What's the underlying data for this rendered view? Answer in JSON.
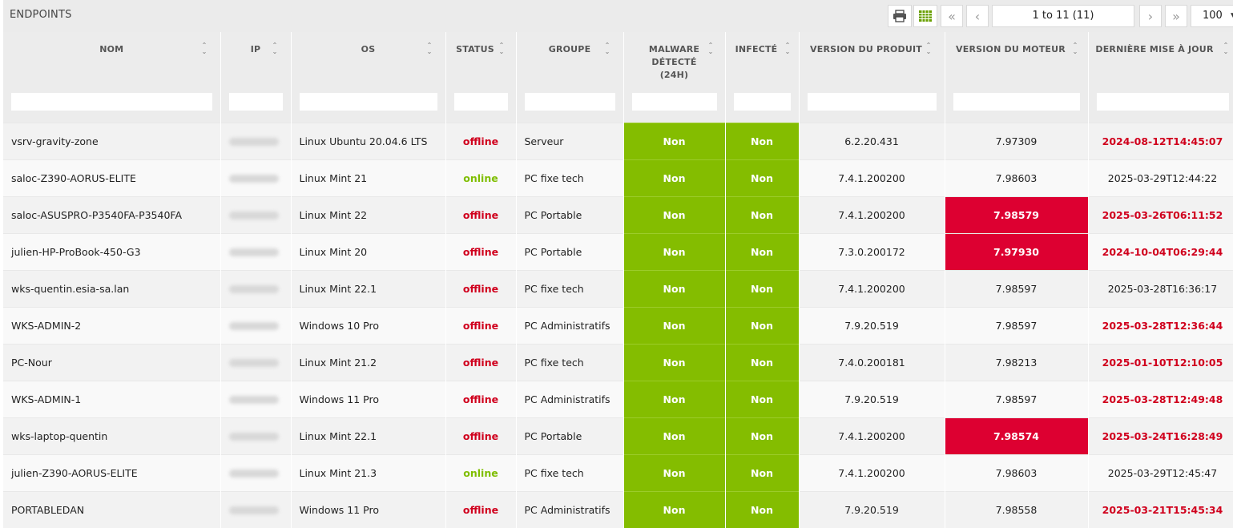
{
  "toolbar": {
    "title": "ENDPOINTS",
    "pagination": "1 to 11 (11)",
    "page_size": "100"
  },
  "columns": [
    "NOM",
    "IP",
    "OS",
    "STATUS",
    "GROUPE",
    "MALWARE DÉTECTÉ (24H)",
    "INFECTÉ",
    "VERSION DU PRODUIT",
    "VERSION DU MOTEUR",
    "DERNIÈRE MISE À JOUR"
  ],
  "colors": {
    "green": "#84bd00",
    "red": "#dd0031",
    "offline": "#d0001d",
    "online": "#7fbe00"
  },
  "rows": [
    {
      "nom": "vsrv-gravity-zone",
      "os": "Linux Ubuntu 20.04.6 LTS",
      "status": "offline",
      "groupe": "Serveur",
      "malware": "Non",
      "infecte": "Non",
      "produit": "6.2.20.431",
      "moteur": "7.97309",
      "moteur_alert": false,
      "maj": "2024-08-12T14:45:07",
      "maj_alert": true
    },
    {
      "nom": "saloc-Z390-AORUS-ELITE",
      "os": "Linux Mint 21",
      "status": "online",
      "groupe": "PC fixe tech",
      "malware": "Non",
      "infecte": "Non",
      "produit": "7.4.1.200200",
      "moteur": "7.98603",
      "moteur_alert": false,
      "maj": "2025-03-29T12:44:22",
      "maj_alert": false
    },
    {
      "nom": "saloc-ASUSPRO-P3540FA-P3540FA",
      "os": "Linux Mint 22",
      "status": "offline",
      "groupe": "PC Portable",
      "malware": "Non",
      "infecte": "Non",
      "produit": "7.4.1.200200",
      "moteur": "7.98579",
      "moteur_alert": true,
      "maj": "2025-03-26T06:11:52",
      "maj_alert": true
    },
    {
      "nom": "julien-HP-ProBook-450-G3",
      "os": "Linux Mint 20",
      "status": "offline",
      "groupe": "PC Portable",
      "malware": "Non",
      "infecte": "Non",
      "produit": "7.3.0.200172",
      "moteur": "7.97930",
      "moteur_alert": true,
      "maj": "2024-10-04T06:29:44",
      "maj_alert": true
    },
    {
      "nom": "wks-quentin.esia-sa.lan",
      "os": "Linux Mint 22.1",
      "status": "offline",
      "groupe": "PC fixe tech",
      "malware": "Non",
      "infecte": "Non",
      "produit": "7.4.1.200200",
      "moteur": "7.98597",
      "moteur_alert": false,
      "maj": "2025-03-28T16:36:17",
      "maj_alert": false
    },
    {
      "nom": "WKS-ADMIN-2",
      "os": "Windows 10 Pro",
      "status": "offline",
      "groupe": "PC Administratifs",
      "malware": "Non",
      "infecte": "Non",
      "produit": "7.9.20.519",
      "moteur": "7.98597",
      "moteur_alert": false,
      "maj": "2025-03-28T12:36:44",
      "maj_alert": true
    },
    {
      "nom": "PC-Nour",
      "os": "Linux Mint 21.2",
      "status": "offline",
      "groupe": "PC fixe tech",
      "malware": "Non",
      "infecte": "Non",
      "produit": "7.4.0.200181",
      "moteur": "7.98213",
      "moteur_alert": false,
      "maj": "2025-01-10T12:10:05",
      "maj_alert": true
    },
    {
      "nom": "WKS-ADMIN-1",
      "os": "Windows 11 Pro",
      "status": "offline",
      "groupe": "PC Administratifs",
      "malware": "Non",
      "infecte": "Non",
      "produit": "7.9.20.519",
      "moteur": "7.98597",
      "moteur_alert": false,
      "maj": "2025-03-28T12:49:48",
      "maj_alert": true
    },
    {
      "nom": "wks-laptop-quentin",
      "os": "Linux Mint 22.1",
      "status": "offline",
      "groupe": "PC Portable",
      "malware": "Non",
      "infecte": "Non",
      "produit": "7.4.1.200200",
      "moteur": "7.98574",
      "moteur_alert": true,
      "maj": "2025-03-24T16:28:49",
      "maj_alert": true
    },
    {
      "nom": "julien-Z390-AORUS-ELITE",
      "os": "Linux Mint 21.3",
      "status": "online",
      "groupe": "PC fixe tech",
      "malware": "Non",
      "infecte": "Non",
      "produit": "7.4.1.200200",
      "moteur": "7.98603",
      "moteur_alert": false,
      "maj": "2025-03-29T12:45:47",
      "maj_alert": false
    },
    {
      "nom": "PORTABLEDAN",
      "os": "Windows 11 Pro",
      "status": "offline",
      "groupe": "PC Administratifs",
      "malware": "Non",
      "infecte": "Non",
      "produit": "7.9.20.519",
      "moteur": "7.98558",
      "moteur_alert": false,
      "maj": "2025-03-21T15:45:34",
      "maj_alert": true
    }
  ]
}
